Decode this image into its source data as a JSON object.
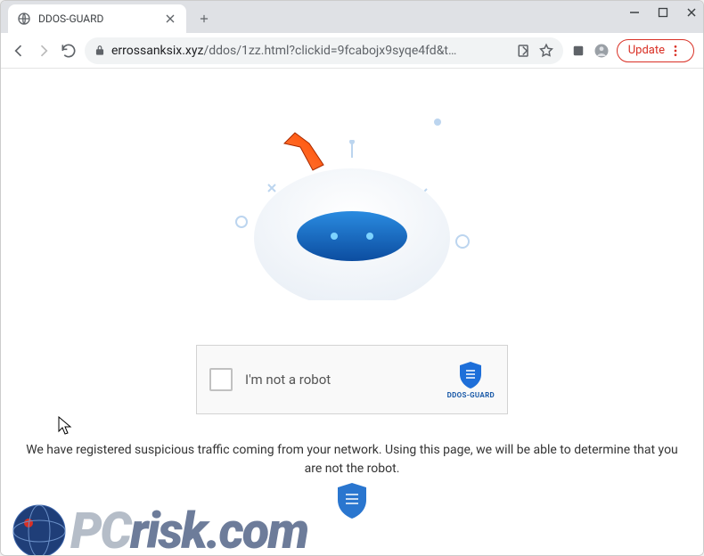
{
  "window": {
    "tab_title": "DDOS-GUARD",
    "controls": {
      "minimize": "–",
      "maximize": "▢",
      "close": "✕"
    }
  },
  "toolbar": {
    "url_host": "errossanksix.xyz",
    "url_path": "/ddos/1zz.html?clickid=9fcabojx9syqe4fd&t…",
    "update_label": "Update"
  },
  "page": {
    "captcha": {
      "label": "I'm not a robot",
      "brand": "DDOS-GUARD"
    },
    "message": "We have registered suspicious traffic coming from your network. Using this page, we will be able to determine that you are not the robot."
  },
  "watermark": {
    "text_prefix": "PC",
    "text_suffix": "risk.com"
  },
  "icons": {
    "shield_color": "#1e6fd9",
    "arrow_color": "#ff5a1f"
  }
}
